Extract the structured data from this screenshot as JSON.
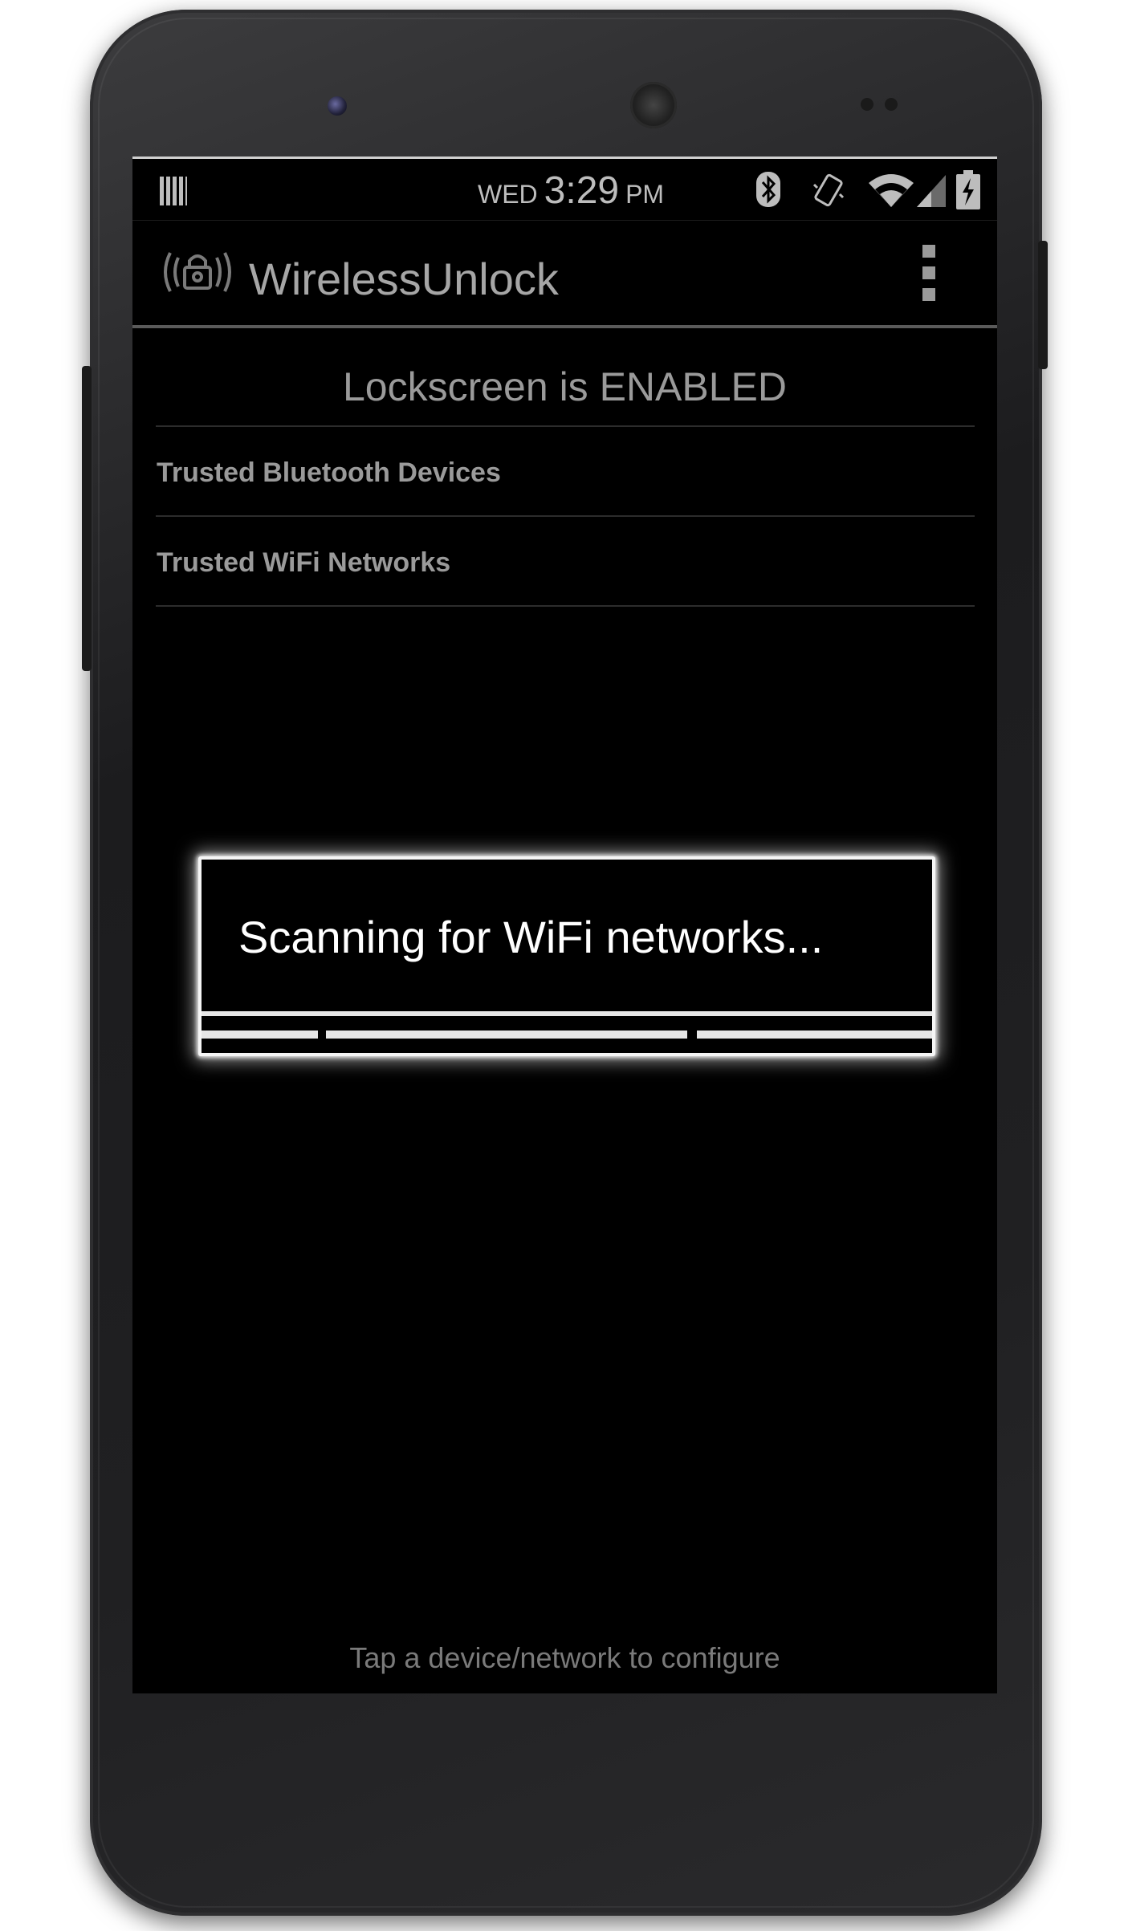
{
  "status_bar": {
    "day": "WED",
    "time": "3:29",
    "ampm": "PM",
    "icons": [
      "notification-barcode-icon",
      "bluetooth-icon",
      "vibrate-icon",
      "wifi-icon",
      "cell-signal-icon",
      "battery-charging-icon"
    ]
  },
  "action_bar": {
    "app_icon": "wireless-lock-icon",
    "title": "WirelessUnlock",
    "overflow_icon": "overflow-menu-icon"
  },
  "main": {
    "lock_status": "Lockscreen is ENABLED",
    "items": [
      {
        "label": "Trusted Bluetooth Devices"
      },
      {
        "label": "Trusted WiFi Networks"
      }
    ],
    "footer_hint": "Tap a device/network to configure"
  },
  "dialog": {
    "message": "Scanning for WiFi networks..."
  },
  "colors": {
    "screen_bg": "#000000",
    "text_dim": "#9a9a9a",
    "dialog_text": "#ffffff",
    "divider": "#2c2c2c"
  }
}
